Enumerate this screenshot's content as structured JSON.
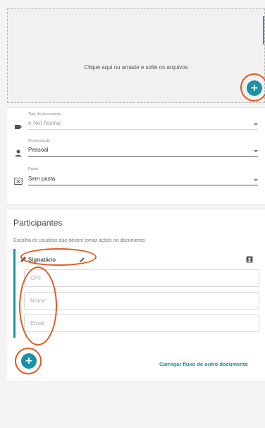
{
  "upload": {
    "prompt": "Clique aqui ou arraste e solte os arquivos",
    "add_icon": "plus-icon",
    "add_label": "+"
  },
  "document_fields": [
    {
      "label": "Tipo do documento",
      "value": "e-Not Assina",
      "icon": "label-tag-icon",
      "muted": true
    },
    {
      "label": "Organização",
      "value": "Pessoal",
      "icon": "person-icon",
      "muted": false
    },
    {
      "label": "Pasta",
      "value": "Sem pasta",
      "icon": "folder-x-icon",
      "muted": false
    }
  ],
  "participants": {
    "title": "Participantes",
    "subtitle": "Escolha os usuários que devem tomar ações no documento:",
    "signer": {
      "role": "Signatário",
      "role_icon": "pen-icon",
      "edit_icon": "pencil-icon",
      "contact_icon": "contact-card-icon",
      "fields": [
        {
          "placeholder": "CPF",
          "value": ""
        },
        {
          "placeholder": "Nome",
          "value": ""
        },
        {
          "placeholder": "Email",
          "value": ""
        }
      ]
    },
    "add_label": "+",
    "load_flow_label": "Carregar fluxo de outro documento"
  },
  "colors": {
    "accent": "#1b91a8",
    "annotation": "#e2581f"
  }
}
